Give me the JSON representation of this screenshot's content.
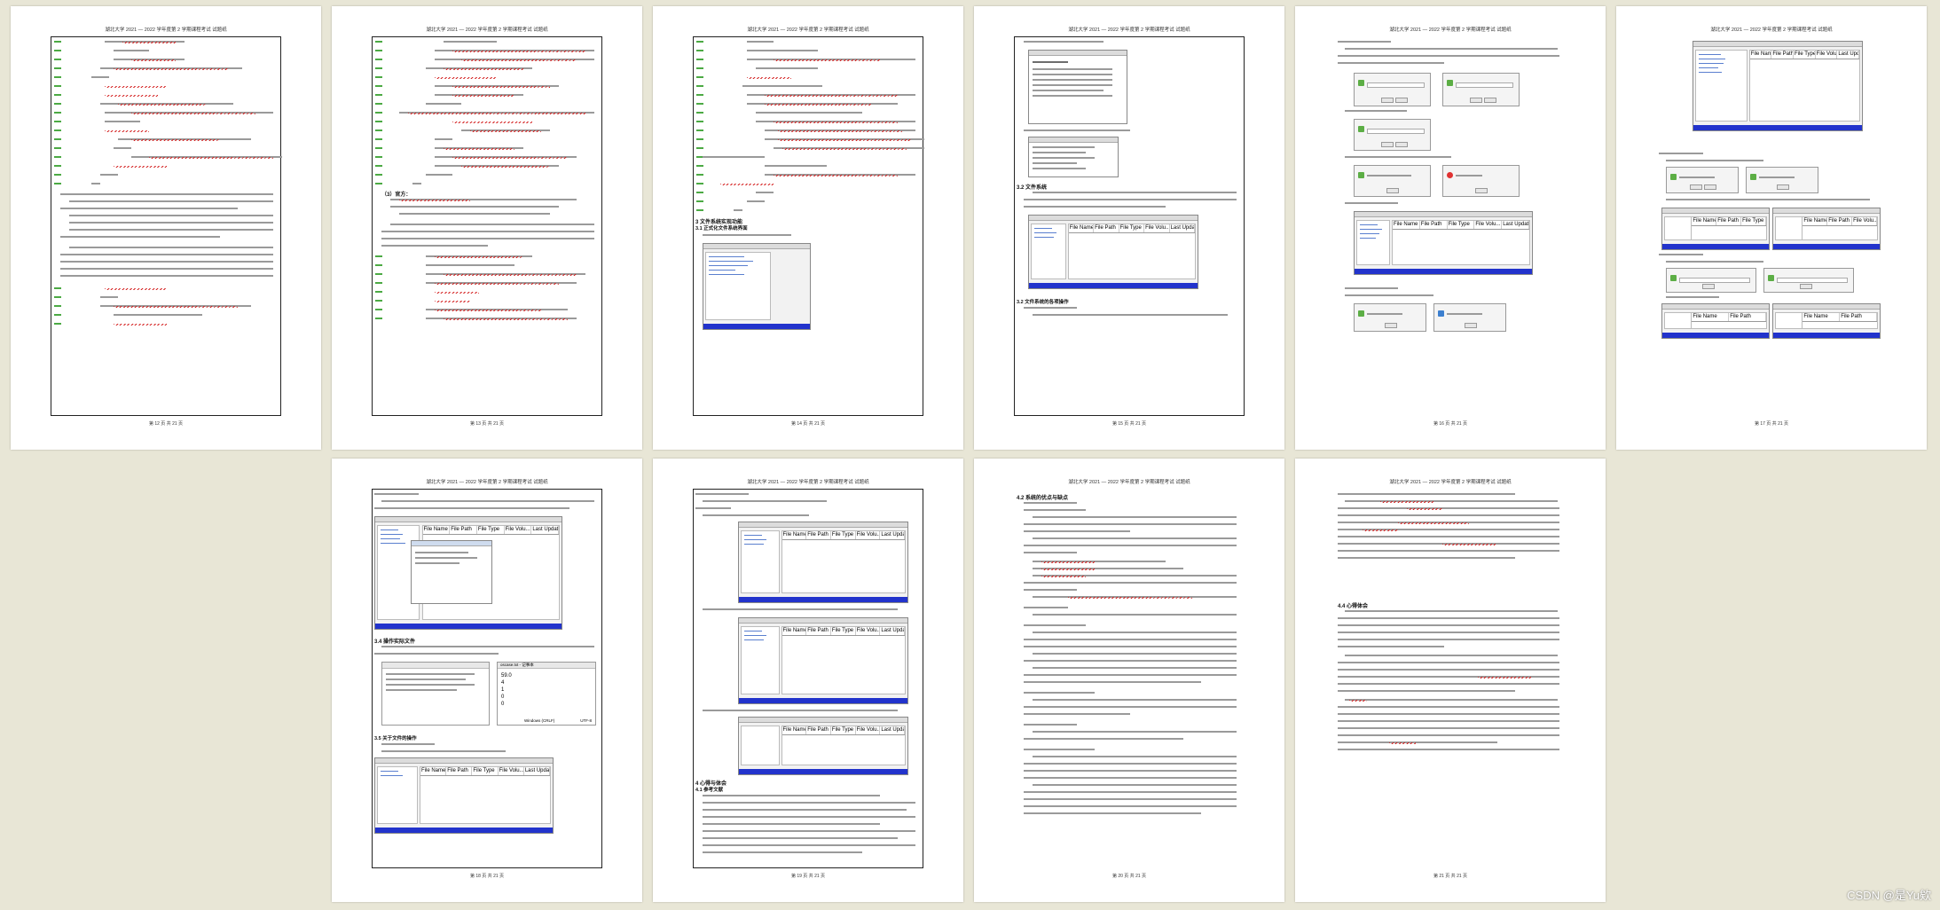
{
  "document": {
    "header_text": "湖北大学 2021 — 2022 学年度第 2 学期课程考试 试题纸",
    "pages": [
      {
        "footer": "第 12 页  共 21 页"
      },
      {
        "footer": "第 13 页  共 21 页"
      },
      {
        "footer": "第 14 页  共 21 页"
      },
      {
        "footer": "第 15 页  共 21 页"
      },
      {
        "footer": "第 16 页  共 21 页"
      },
      {
        "footer": "第 17 页  共 21 页"
      },
      {
        "footer": "第 18 页  共 21 页"
      },
      {
        "footer": "第 19 页  共 21 页"
      },
      {
        "footer": "第 20 页  共 21 页"
      },
      {
        "footer": "第 21 页  共 21 页"
      }
    ]
  },
  "headings": {
    "p2_ref": "（3）官方：",
    "p3_sec": "3 文件系统实现功能",
    "p3_sub": "3.1 正式化文件系统界面",
    "p4_sec": "3.2 文件系统",
    "p4_sub": "3.2 文件系统的各项操作",
    "p7_sec": "3.4 操作实际文件",
    "p7_sub": "3.5 关于文件的操作",
    "p8_sec": "4 心得与体会",
    "p8_sub": "4.1 参考文献",
    "p9_sec": "4.2 系统的优点与缺点",
    "p10_sec": "4.4 心得体会"
  },
  "file_table": {
    "columns": [
      "File Name",
      "File Path",
      "File Type",
      "File Volu...",
      "Last Update"
    ]
  },
  "notepad": {
    "title": "oscase.txt - 记事本",
    "values": [
      "59.0",
      "4",
      "1",
      "0",
      "0"
    ],
    "status": [
      "第 1 行，第 1 列",
      "100%",
      "Windows (CRLF)",
      "UTF-8"
    ]
  },
  "watermark": "CSDN @是Yu欸"
}
